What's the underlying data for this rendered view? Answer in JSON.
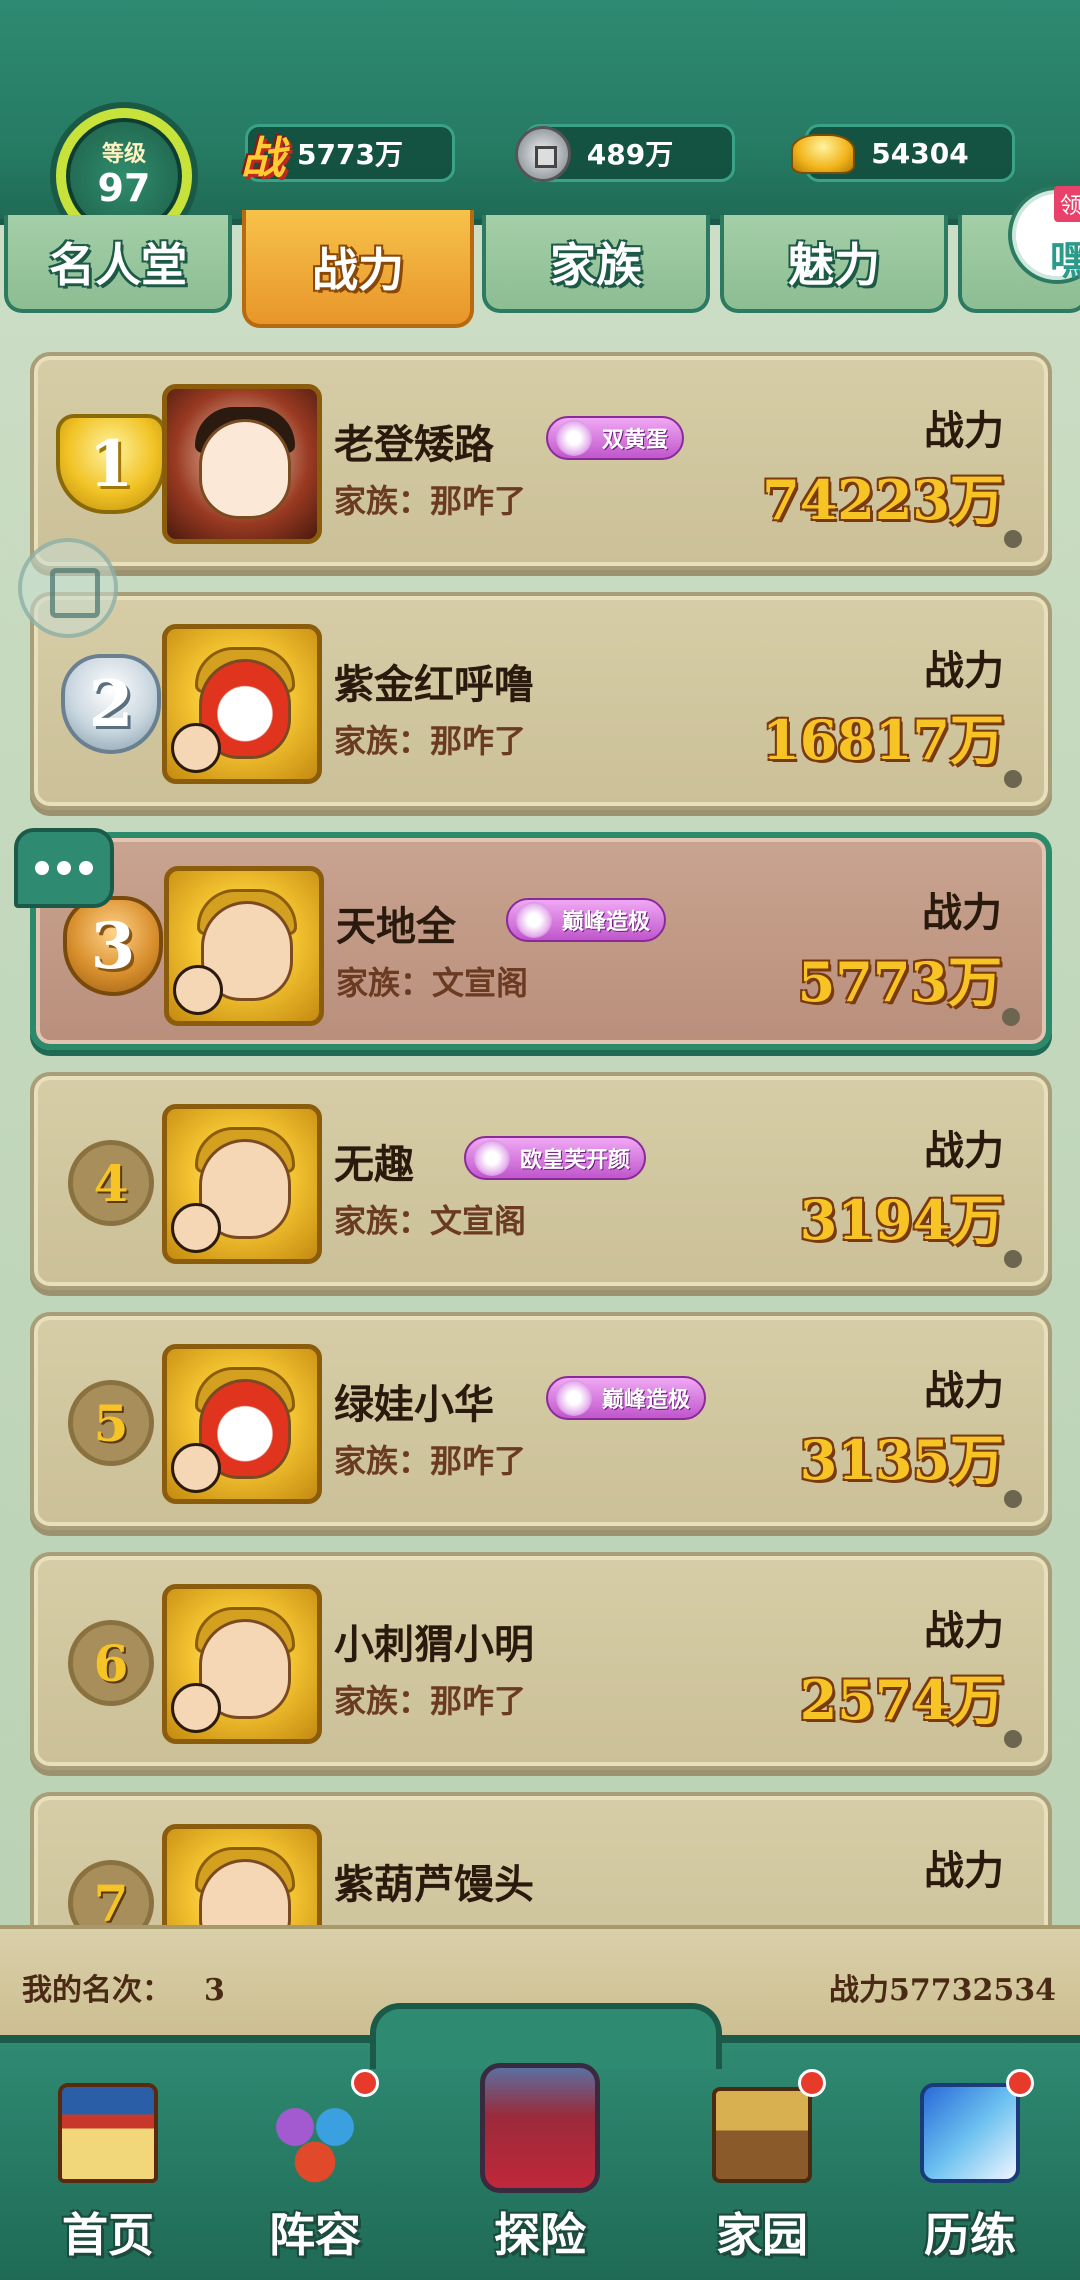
{
  "header": {
    "level_label": "等级",
    "level_value": "97",
    "power_icon_text": "战",
    "power_value": "5773万",
    "silver_value": "489万",
    "gold_value": "54304",
    "gift_tag": "领",
    "gift_text": "嘿"
  },
  "tabs": [
    {
      "label": "名人堂",
      "active": false
    },
    {
      "label": "战力",
      "active": true
    },
    {
      "label": "家族",
      "active": false
    },
    {
      "label": "魅力",
      "active": false
    }
  ],
  "list": {
    "power_label": "战力",
    "rows": [
      {
        "rank": "1",
        "name": "老登矮路",
        "badge": "双黄蛋",
        "clan": "家族：那咋了",
        "power": "74223万"
      },
      {
        "rank": "2",
        "name": "紫金红呼噜",
        "badge": "",
        "clan": "家族：那咋了",
        "power": "16817万"
      },
      {
        "rank": "3",
        "name": "天地全",
        "badge": "巅峰造极",
        "clan": "家族：文宣阁",
        "power": "5773万"
      },
      {
        "rank": "4",
        "name": "无趣",
        "badge": "欧皇芙开颜",
        "clan": "家族：文宣阁",
        "power": "3194万"
      },
      {
        "rank": "5",
        "name": "绿娃小华",
        "badge": "巅峰造极",
        "clan": "家族：那咋了",
        "power": "3135万"
      },
      {
        "rank": "6",
        "name": "小刺猬小明",
        "badge": "",
        "clan": "家族：那咋了",
        "power": "2574万"
      },
      {
        "rank": "7",
        "name": "紫葫芦馒头",
        "badge": "",
        "clan": "",
        "power": ""
      }
    ]
  },
  "my_rank": {
    "label": "我的名次：",
    "value": "3",
    "power_text": "战力57732534"
  },
  "nav": [
    {
      "label": "首页",
      "icon": "palace-gate-icon",
      "dot": false
    },
    {
      "label": "阵容",
      "icon": "gourds-icon",
      "dot": true
    },
    {
      "label": "探险",
      "icon": "explore-gate-icon",
      "dot": false
    },
    {
      "label": "家园",
      "icon": "house-icon",
      "dot": true
    },
    {
      "label": "历练",
      "icon": "sword-mountain-icon",
      "dot": true
    }
  ],
  "colors": {
    "topbar": "#2f8a72",
    "active_tab": "#f0a83a",
    "power_gold": "#f7c426",
    "highlight_border": "#2b8a6a",
    "badge_purple": "#c056cc"
  }
}
